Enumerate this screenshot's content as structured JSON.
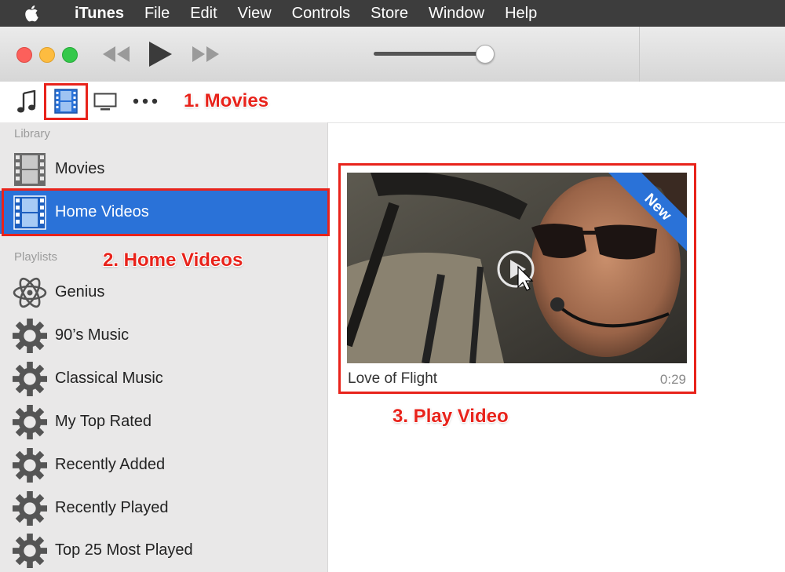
{
  "menubar": {
    "apple_icon": "apple-logo-icon",
    "items": [
      "iTunes",
      "File",
      "Edit",
      "View",
      "Controls",
      "Store",
      "Window",
      "Help"
    ]
  },
  "toolbar": {
    "icons": [
      "previous-track-icon",
      "play-icon",
      "next-track-icon"
    ],
    "volume_level": 0.9
  },
  "mediabar": {
    "icons": [
      "music-note-icon",
      "film-icon",
      "tv-icon",
      "more-dots-icon"
    ],
    "selected": "film-icon"
  },
  "annotations": {
    "step1": "1. Movies",
    "step2": "2. Home Videos",
    "step3": "3. Play Video"
  },
  "sidebar": {
    "library_header": "Library",
    "library_items": [
      {
        "label": "Movies",
        "icon": "film-strip-icon"
      },
      {
        "label": "Home Videos",
        "icon": "home-video-icon",
        "selected": true
      }
    ],
    "playlists_header": "Playlists",
    "playlist_items": [
      {
        "label": "Genius",
        "icon": "atom-icon"
      },
      {
        "label": "90’s Music",
        "icon": "gear-icon"
      },
      {
        "label": "Classical Music",
        "icon": "gear-icon"
      },
      {
        "label": "My Top Rated",
        "icon": "gear-icon"
      },
      {
        "label": "Recently Added",
        "icon": "gear-icon"
      },
      {
        "label": "Recently Played",
        "icon": "gear-icon"
      },
      {
        "label": "Top 25 Most Played",
        "icon": "gear-icon"
      }
    ]
  },
  "video": {
    "title": "Love of Flight",
    "duration": "0:29",
    "badge": "New"
  },
  "colors": {
    "accent": "#2a72d8",
    "annotation": "#e8231b"
  }
}
